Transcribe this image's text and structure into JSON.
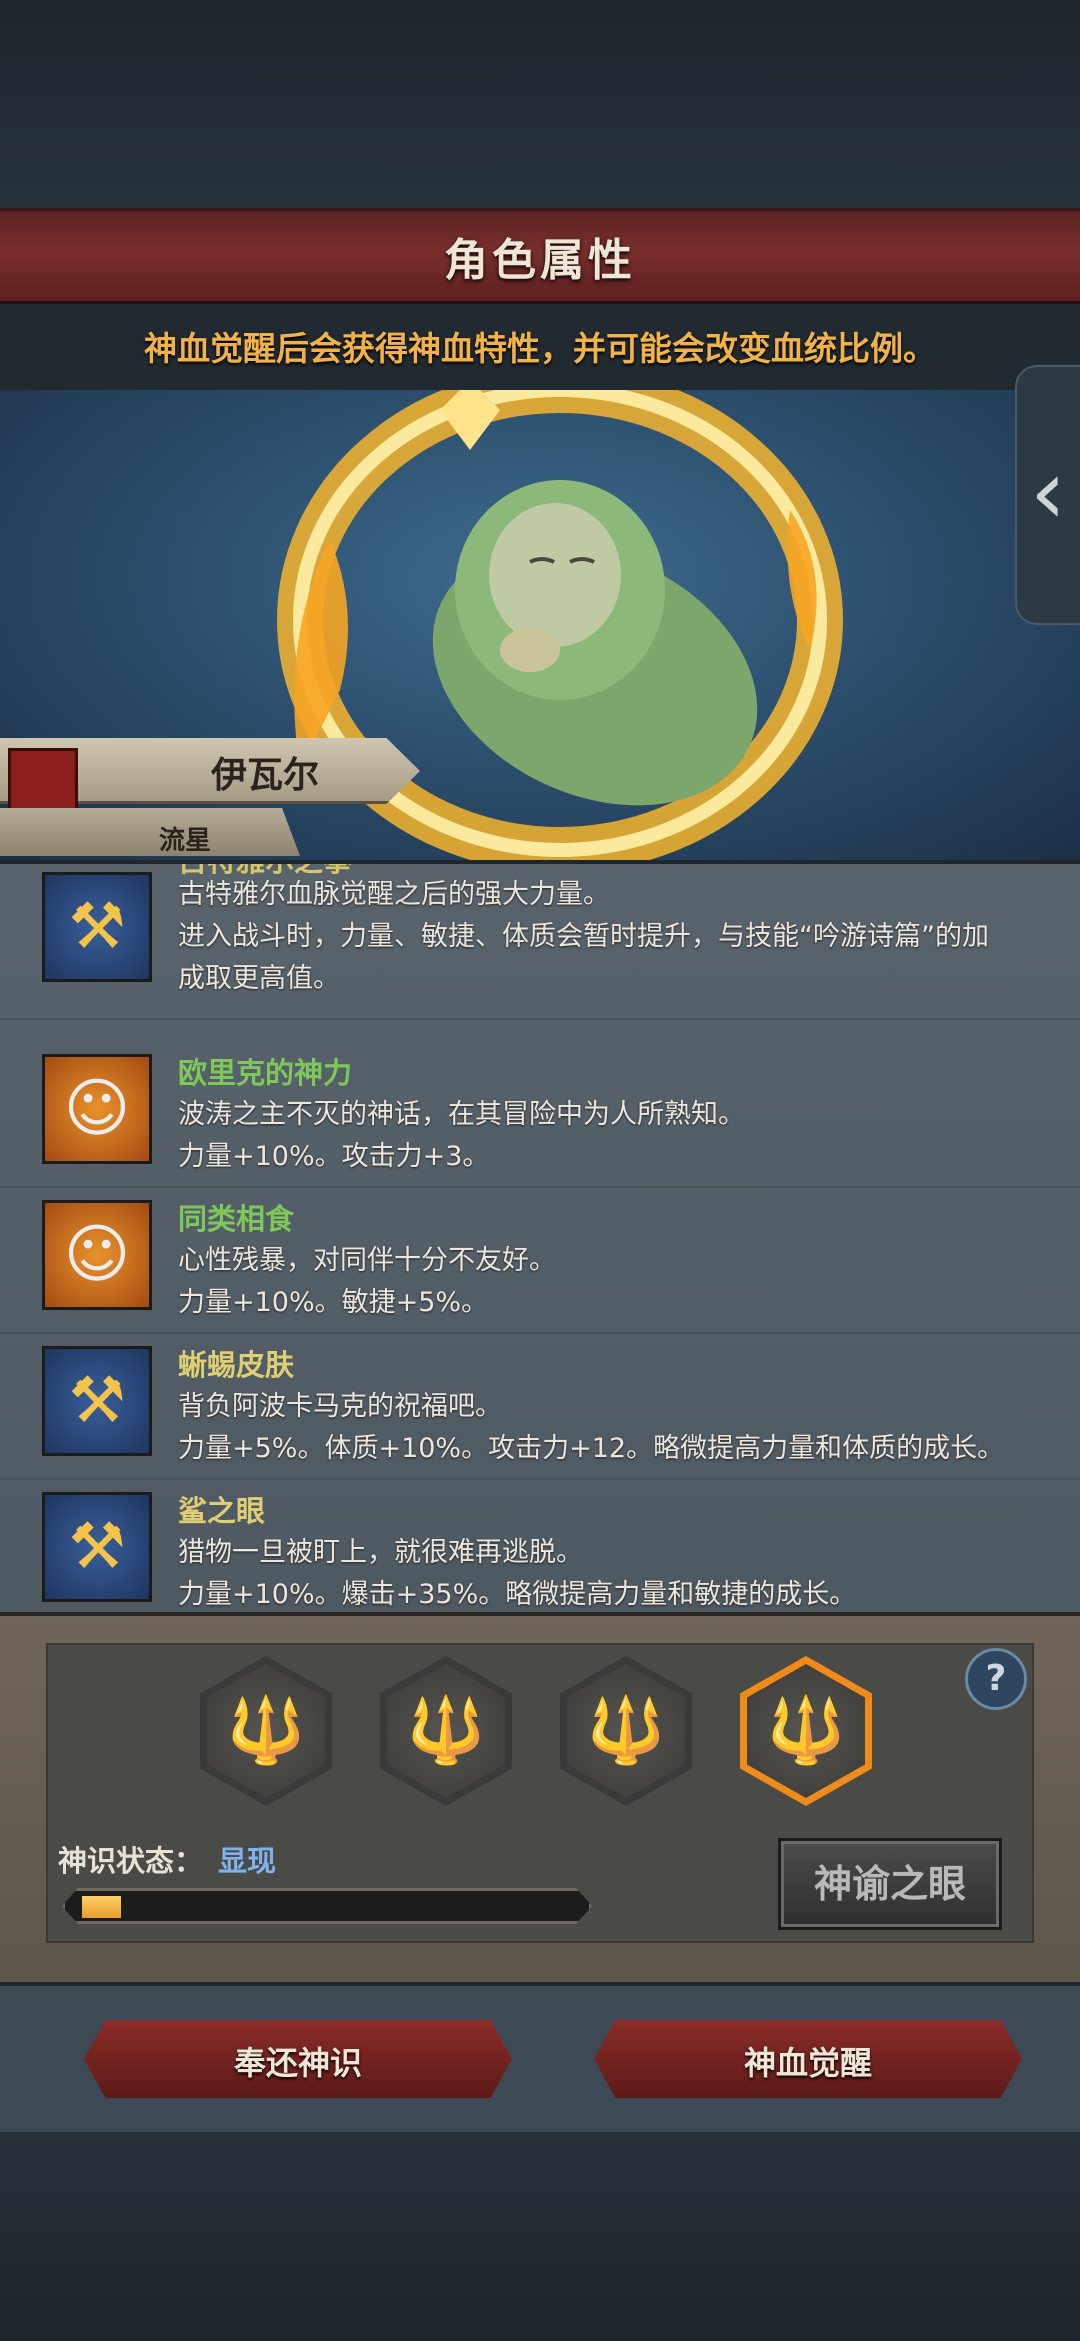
{
  "header": {
    "title": "角色属性",
    "subtitle": "神血觉醒后会获得神血特性，并可能会改变血统比例。"
  },
  "character": {
    "name": "伊瓦尔",
    "epithet": "流星"
  },
  "traits": [
    {
      "name": "古特雅尔之拳",
      "name_color": "#d9c56a",
      "icon": "golden-axe-icon",
      "lines": [
        "古特雅尔血脉觉醒之后的强大力量。",
        "进入战斗时，力量、敏捷、体质会暂时提升，与技能“吟游诗篇”的加",
        "成取更高值。"
      ]
    },
    {
      "name": "欧里克的神力",
      "name_color": "#7ec85a",
      "icon": "smiling-face-icon",
      "lines": [
        "波涛之主不灭的神话，在其冒险中为人所熟知。",
        "力量+10%。攻击力+3。"
      ]
    },
    {
      "name": "同类相食",
      "name_color": "#7ec85a",
      "icon": "smiling-face-icon",
      "lines": [
        "心性残暴，对同伴十分不友好。",
        "力量+10%。敏捷+5%。"
      ]
    },
    {
      "name": "蜥蜴皮肤",
      "name_color": "#e0cf72",
      "icon": "golden-axe-icon",
      "lines": [
        "背负阿波卡马克的祝福吧。",
        "力量+5%。体质+10%。攻击力+12。略微提高力量和体质的成长。"
      ]
    },
    {
      "name": "鲨之眼",
      "name_color": "#e0cf72",
      "icon": "golden-axe-icon",
      "lines": [
        "猎物一旦被盯上，就很难再逃脱。",
        "力量+10%。爆击+35%。略微提高力量和敏捷的成长。"
      ]
    }
  ],
  "god_panel": {
    "state_label": "神识状态：",
    "state_value": "显现",
    "progress": 0.08,
    "oracle_button": "神谕之眼",
    "help": "?",
    "slots": [
      {
        "icon": "flaming-trident-icon",
        "active": false
      },
      {
        "icon": "flaming-trident-icon",
        "active": false
      },
      {
        "icon": "flaming-trident-icon",
        "active": false
      },
      {
        "icon": "flaming-trident-icon",
        "active": true
      }
    ]
  },
  "footer": {
    "return_button": "奉还神识",
    "awaken_button": "神血觉醒"
  },
  "colors": {
    "accent_orange": "#f2b24a",
    "active_slot": "#f08a18",
    "state_value": "#7fb2ee"
  }
}
